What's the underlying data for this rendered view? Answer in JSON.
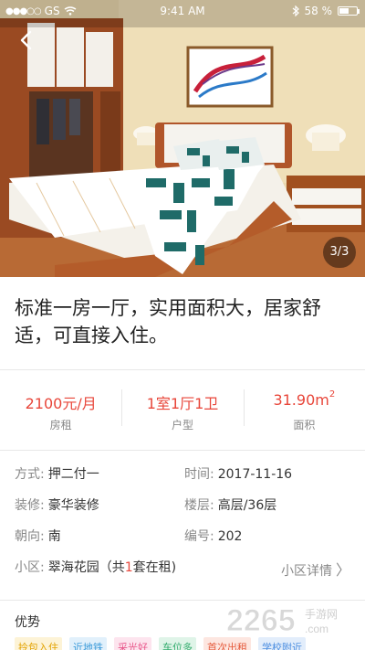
{
  "status_bar": {
    "carrier": "GS",
    "time": "9:41 AM",
    "battery": "58 %",
    "battery_level": 0.58
  },
  "photo": {
    "counter": "3/3"
  },
  "listing": {
    "title": "标准一房一厅，实用面积大，居家舒适，可直接入住。"
  },
  "stats": [
    {
      "value": "2100元/月",
      "label": "房租"
    },
    {
      "value": "1室1厅1卫",
      "label": "户型"
    },
    {
      "value": "31.90m",
      "sup": "2",
      "label": "面积"
    }
  ],
  "details": {
    "payment_key": "方式:",
    "payment_val": "押二付一",
    "time_key": "时间:",
    "time_val": "2017-11-16",
    "decor_key": "装修:",
    "decor_val": "豪华装修",
    "floor_key": "楼层:",
    "floor_val": "高层/36层",
    "orient_key": "朝向:",
    "orient_val": "南",
    "id_key": "编号:",
    "id_val": "202",
    "community_key": "小区:",
    "community_pre": "翠海花园（共",
    "community_count": "1",
    "community_post": "套在租)",
    "community_link": "小区详情"
  },
  "advantages": {
    "title": "优势",
    "tags": [
      {
        "label": "拎包入住",
        "color": "#e2a200",
        "bg": "#fdf3d6"
      },
      {
        "label": "近地铁",
        "color": "#3a9ad9",
        "bg": "#e1f0fb"
      },
      {
        "label": "采光好",
        "color": "#e8568a",
        "bg": "#fde4ee"
      },
      {
        "label": "车位多",
        "color": "#2eaa6a",
        "bg": "#dff4e8"
      },
      {
        "label": "首次出租",
        "color": "#e55a3c",
        "bg": "#fde6e0"
      },
      {
        "label": "学校附近",
        "color": "#4b8de0",
        "bg": "#e2edfb"
      }
    ]
  },
  "watermark": {
    "text": "2265",
    "sub": ".com",
    "cn": "手游网"
  },
  "colors": {
    "accent": "#e8463a"
  },
  "icons": [
    "back-arrow-icon",
    "wifi-icon",
    "bluetooth-icon",
    "battery-icon",
    "chevron-right-icon"
  ]
}
